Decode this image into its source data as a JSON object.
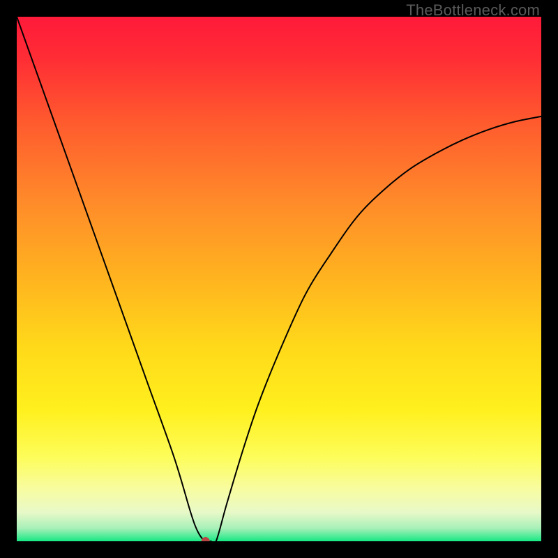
{
  "watermark": "TheBottleneck.com",
  "chart_data": {
    "type": "line",
    "title": "",
    "xlabel": "",
    "ylabel": "",
    "xlim": [
      0,
      100
    ],
    "ylim": [
      0,
      100
    ],
    "grid": false,
    "legend": false,
    "marker": {
      "x": 36,
      "y": 0,
      "color": "#bb4444",
      "radius": 6
    },
    "series": [
      {
        "name": "curve",
        "color": "#000000",
        "width": 2,
        "x": [
          0,
          5,
          10,
          15,
          20,
          25,
          30,
          33,
          34,
          35,
          36,
          37,
          38,
          40,
          43,
          46,
          50,
          55,
          60,
          65,
          70,
          75,
          80,
          85,
          90,
          95,
          100
        ],
        "y": [
          100,
          86,
          72,
          58,
          44,
          30,
          16,
          6,
          3,
          1,
          0,
          0,
          0,
          7,
          17,
          26,
          36,
          47,
          55,
          62,
          67,
          71,
          74,
          76.5,
          78.5,
          80,
          81
        ]
      }
    ],
    "gradient_stops": [
      {
        "offset": 0.0,
        "color": "#ff1a3a"
      },
      {
        "offset": 0.08,
        "color": "#ff2d35"
      },
      {
        "offset": 0.2,
        "color": "#ff5a2e"
      },
      {
        "offset": 0.35,
        "color": "#ff8a2a"
      },
      {
        "offset": 0.5,
        "color": "#ffb41f"
      },
      {
        "offset": 0.63,
        "color": "#ffd91a"
      },
      {
        "offset": 0.75,
        "color": "#fff01e"
      },
      {
        "offset": 0.84,
        "color": "#fdfd5a"
      },
      {
        "offset": 0.9,
        "color": "#f8fca0"
      },
      {
        "offset": 0.945,
        "color": "#e8f9c8"
      },
      {
        "offset": 0.975,
        "color": "#a8f0b8"
      },
      {
        "offset": 1.0,
        "color": "#17e884"
      }
    ]
  }
}
